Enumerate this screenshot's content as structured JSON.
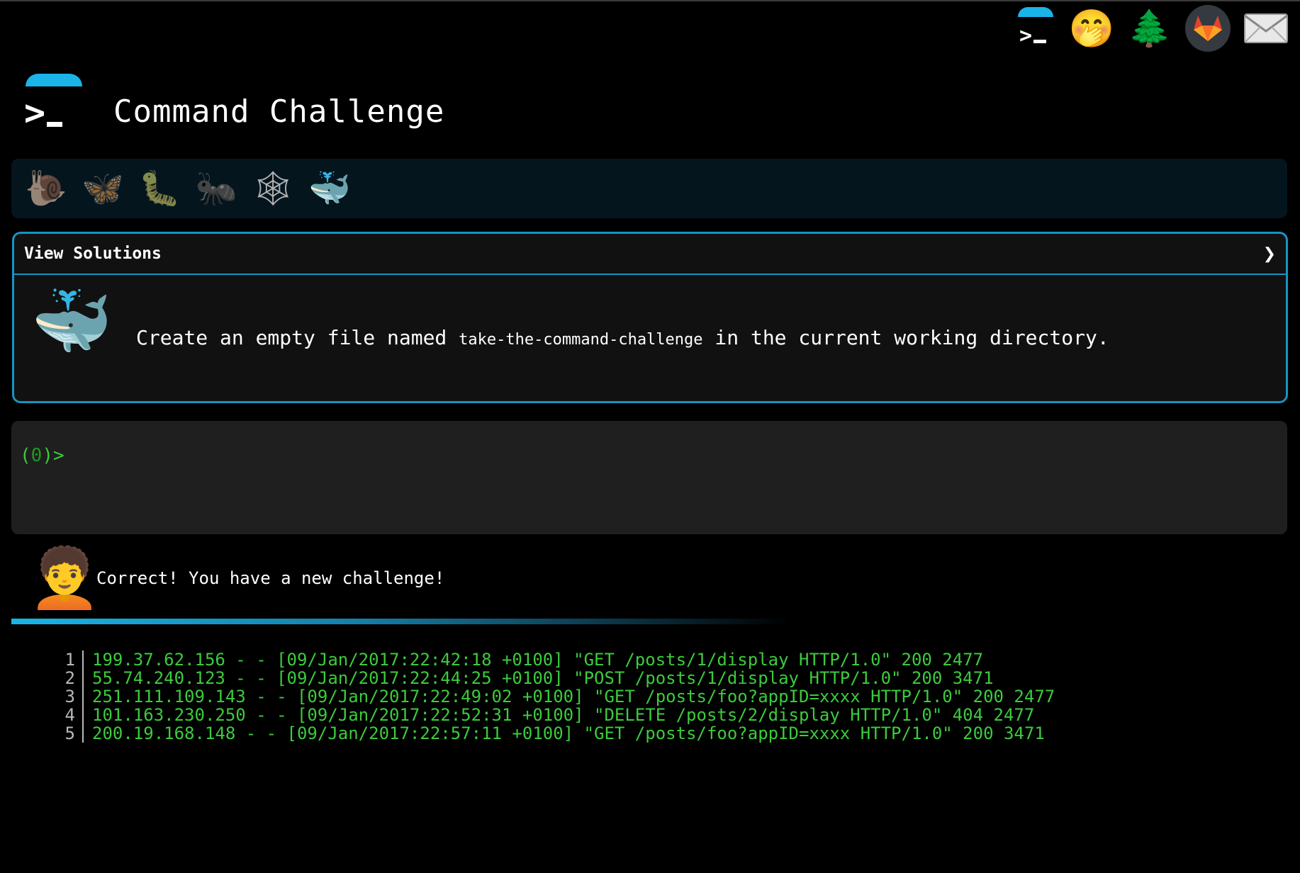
{
  "app": {
    "title": "Command Challenge"
  },
  "topnav": {
    "items": [
      {
        "name": "home-logo-icon",
        "glyph": ""
      },
      {
        "name": "oops-face-icon",
        "glyph": "🤭"
      },
      {
        "name": "tree-icon",
        "glyph": "🌲"
      },
      {
        "name": "gitlab-icon",
        "glyph": ""
      },
      {
        "name": "mail-icon",
        "glyph": "✉"
      }
    ]
  },
  "levels": [
    {
      "name": "snail-icon",
      "glyph": "🐌",
      "active": false
    },
    {
      "name": "butterfly-icon",
      "glyph": "🦋",
      "active": false
    },
    {
      "name": "caterpillar-icon",
      "glyph": "🐛",
      "active": false
    },
    {
      "name": "ant-icon",
      "glyph": "🐜",
      "active": false
    },
    {
      "name": "spider-web-icon",
      "glyph": "🕸",
      "active": false
    },
    {
      "name": "whale-icon",
      "glyph": "🐳",
      "active": true
    }
  ],
  "challenge": {
    "solutions_label": "View Solutions",
    "toggle_glyph": "❯",
    "icon_glyph": "🐳",
    "task_prefix": "Create an empty file named ",
    "task_code": "take-the-command-challenge",
    "task_suffix": " in the current working directory."
  },
  "terminal": {
    "prompt_open": "(",
    "prompt_count": "0",
    "prompt_close": ")>"
  },
  "feedback": {
    "avatar_glyph": "🧑‍🦱",
    "message": "Correct! You have a new challenge!"
  },
  "log": {
    "lines": [
      {
        "num": "1",
        "text": "199.37.62.156 - - [09/Jan/2017:22:42:18 +0100] \"GET /posts/1/display HTTP/1.0\" 200 2477"
      },
      {
        "num": "2",
        "text": "55.74.240.123 - - [09/Jan/2017:22:44:25 +0100] \"POST /posts/1/display HTTP/1.0\" 200 3471"
      },
      {
        "num": "3",
        "text": "251.111.109.143 - - [09/Jan/2017:22:49:02 +0100] \"GET /posts/foo?appID=xxxx HTTP/1.0\" 200 2477"
      },
      {
        "num": "4",
        "text": "101.163.230.250 - - [09/Jan/2017:22:52:31 +0100] \"DELETE /posts/2/display HTTP/1.0\" 404 2477"
      },
      {
        "num": "5",
        "text": "200.19.168.148 - - [09/Jan/2017:22:57:11 +0100] \"GET /posts/foo?appID=xxxx HTTP/1.0\" 200 3471"
      }
    ]
  },
  "colors": {
    "accent": "#1ab4e8",
    "border": "#1694c2",
    "terminal_green": "#3ccb3c",
    "background": "#000000"
  }
}
